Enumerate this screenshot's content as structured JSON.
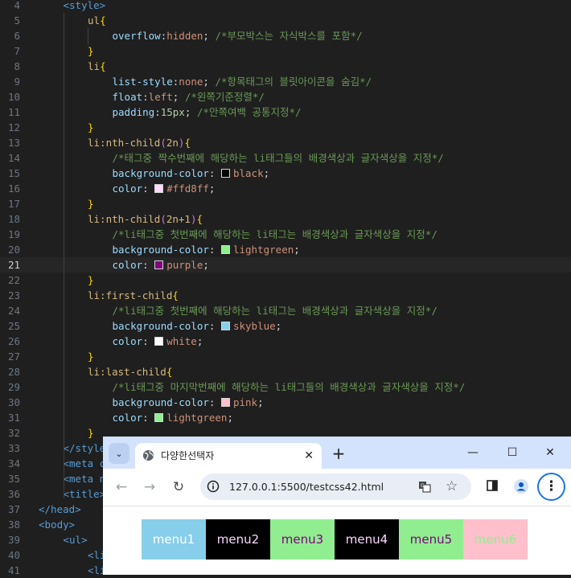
{
  "editor": {
    "active_line": "21",
    "lines": [
      {
        "num": "4",
        "tokens": [
          {
            "t": "tag",
            "v": "<style>"
          }
        ]
      },
      {
        "num": "5",
        "tokens": [
          {
            "t": "sel",
            "v": "ul"
          },
          {
            "t": "brace",
            "v": "{"
          }
        ]
      },
      {
        "num": "6",
        "tokens": [
          {
            "t": "prop",
            "v": "overflow"
          },
          {
            "t": "txt",
            "v": ":"
          },
          {
            "t": "val",
            "v": "hidden"
          },
          {
            "t": "txt",
            "v": "; "
          },
          {
            "t": "com",
            "v": "/*부모박스는 자식박스를 포함*/"
          }
        ]
      },
      {
        "num": "7",
        "tokens": [
          {
            "t": "brace",
            "v": "}"
          }
        ]
      },
      {
        "num": "8",
        "tokens": [
          {
            "t": "sel",
            "v": "li"
          },
          {
            "t": "brace",
            "v": "{"
          }
        ]
      },
      {
        "num": "9",
        "tokens": [
          {
            "t": "prop",
            "v": "list-style"
          },
          {
            "t": "txt",
            "v": ":"
          },
          {
            "t": "val",
            "v": "none"
          },
          {
            "t": "txt",
            "v": "; "
          },
          {
            "t": "com",
            "v": "/*항목태그의 블릿아이콘을 숨김*/"
          }
        ]
      },
      {
        "num": "10",
        "tokens": [
          {
            "t": "prop",
            "v": "float"
          },
          {
            "t": "txt",
            "v": ":"
          },
          {
            "t": "val",
            "v": "left"
          },
          {
            "t": "txt",
            "v": "; "
          },
          {
            "t": "com",
            "v": "/*왼쪽기준정렬*/"
          }
        ]
      },
      {
        "num": "11",
        "tokens": [
          {
            "t": "prop",
            "v": "padding"
          },
          {
            "t": "txt",
            "v": ":"
          },
          {
            "t": "num",
            "v": "15px"
          },
          {
            "t": "txt",
            "v": "; "
          },
          {
            "t": "com",
            "v": "/*안쪽여백 공통지정*/"
          }
        ]
      },
      {
        "num": "12",
        "tokens": [
          {
            "t": "brace",
            "v": "}"
          }
        ]
      },
      {
        "num": "13",
        "tokens": [
          {
            "t": "sel",
            "v": "li:nth-child"
          },
          {
            "t": "paren",
            "v": "("
          },
          {
            "t": "sel",
            "v": "2n"
          },
          {
            "t": "paren",
            "v": ")"
          },
          {
            "t": "brace",
            "v": "{"
          }
        ]
      },
      {
        "num": "14",
        "tokens": [
          {
            "t": "com",
            "v": "/*태그중 짝수번째에 해당하는 li태그들의 배경색상과 글자색상을 지정*/"
          }
        ]
      },
      {
        "num": "15",
        "tokens": [
          {
            "t": "prop",
            "v": "background-color"
          },
          {
            "t": "txt",
            "v": ": "
          },
          {
            "t": "swatch",
            "v": "#000000"
          },
          {
            "t": "val",
            "v": "black"
          },
          {
            "t": "txt",
            "v": ";"
          }
        ]
      },
      {
        "num": "16",
        "tokens": [
          {
            "t": "prop",
            "v": "color"
          },
          {
            "t": "txt",
            "v": ": "
          },
          {
            "t": "swatch",
            "v": "#ffd8ff"
          },
          {
            "t": "val",
            "v": "#ffd8ff"
          },
          {
            "t": "txt",
            "v": ";"
          }
        ]
      },
      {
        "num": "17",
        "tokens": [
          {
            "t": "brace",
            "v": "}"
          }
        ]
      },
      {
        "num": "18",
        "tokens": [
          {
            "t": "sel",
            "v": "li:nth-child"
          },
          {
            "t": "paren",
            "v": "("
          },
          {
            "t": "sel",
            "v": "2n+1"
          },
          {
            "t": "paren",
            "v": ")"
          },
          {
            "t": "brace",
            "v": "{"
          }
        ]
      },
      {
        "num": "19",
        "tokens": [
          {
            "t": "com",
            "v": "/*li태그중 첫번째에 해당하는 li태그는 배경색상과 글자색상을 지정*/"
          }
        ]
      },
      {
        "num": "20",
        "tokens": [
          {
            "t": "prop",
            "v": "background-color"
          },
          {
            "t": "txt",
            "v": ": "
          },
          {
            "t": "swatch",
            "v": "#90ee90"
          },
          {
            "t": "val",
            "v": "lightgreen"
          },
          {
            "t": "txt",
            "v": ";"
          }
        ]
      },
      {
        "num": "21",
        "tokens": [
          {
            "t": "prop",
            "v": "color"
          },
          {
            "t": "txt",
            "v": ": "
          },
          {
            "t": "swatch",
            "v": "#800080"
          },
          {
            "t": "val",
            "v": "purple"
          },
          {
            "t": "txt",
            "v": ";"
          }
        ]
      },
      {
        "num": "22",
        "tokens": [
          {
            "t": "brace",
            "v": "}"
          }
        ]
      },
      {
        "num": "23",
        "tokens": [
          {
            "t": "sel",
            "v": "li:first-child"
          },
          {
            "t": "brace",
            "v": "{"
          }
        ]
      },
      {
        "num": "24",
        "tokens": [
          {
            "t": "com",
            "v": "/*li태그중 첫번째에 해당하는 li태그는 배경색상과 글자색상을 지정*/"
          }
        ]
      },
      {
        "num": "25",
        "tokens": [
          {
            "t": "prop",
            "v": "background-color"
          },
          {
            "t": "txt",
            "v": ": "
          },
          {
            "t": "swatch",
            "v": "#87ceeb"
          },
          {
            "t": "val",
            "v": "skyblue"
          },
          {
            "t": "txt",
            "v": ";"
          }
        ]
      },
      {
        "num": "26",
        "tokens": [
          {
            "t": "prop",
            "v": "color"
          },
          {
            "t": "txt",
            "v": ": "
          },
          {
            "t": "swatch",
            "v": "#ffffff"
          },
          {
            "t": "val",
            "v": "white"
          },
          {
            "t": "txt",
            "v": ";"
          }
        ]
      },
      {
        "num": "27",
        "tokens": [
          {
            "t": "brace",
            "v": "}"
          }
        ]
      },
      {
        "num": "28",
        "tokens": [
          {
            "t": "sel",
            "v": "li:last-child"
          },
          {
            "t": "brace",
            "v": "{"
          }
        ]
      },
      {
        "num": "29",
        "tokens": [
          {
            "t": "com",
            "v": "/*li태그중 마지막번째에 해당하는 li태그들의 배경색상과 글자색상을 지정*/"
          }
        ]
      },
      {
        "num": "30",
        "tokens": [
          {
            "t": "prop",
            "v": "background-color"
          },
          {
            "t": "txt",
            "v": ": "
          },
          {
            "t": "swatch",
            "v": "#ffc0cb"
          },
          {
            "t": "val",
            "v": "pink"
          },
          {
            "t": "txt",
            "v": ";"
          }
        ]
      },
      {
        "num": "31",
        "tokens": [
          {
            "t": "prop",
            "v": "color"
          },
          {
            "t": "txt",
            "v": ": "
          },
          {
            "t": "swatch",
            "v": "#90ee90"
          },
          {
            "t": "val",
            "v": "lightgreen"
          },
          {
            "t": "txt",
            "v": ";"
          }
        ]
      },
      {
        "num": "32",
        "tokens": [
          {
            "t": "brace",
            "v": "}"
          }
        ]
      },
      {
        "num": "33",
        "tokens": [
          {
            "t": "tag",
            "v": "</style"
          }
        ]
      },
      {
        "num": "34",
        "tokens": [
          {
            "t": "tag",
            "v": "<meta c"
          }
        ]
      },
      {
        "num": "35",
        "tokens": [
          {
            "t": "tag",
            "v": "<meta n"
          }
        ]
      },
      {
        "num": "36",
        "tokens": [
          {
            "t": "tag",
            "v": "<title>"
          }
        ]
      },
      {
        "num": "37",
        "tokens": [
          {
            "t": "tag",
            "v": "</head>"
          }
        ]
      },
      {
        "num": "38",
        "tokens": [
          {
            "t": "tag",
            "v": "<body>"
          }
        ]
      },
      {
        "num": "39",
        "tokens": [
          {
            "t": "tag",
            "v": "<ul>"
          }
        ]
      },
      {
        "num": "40",
        "tokens": [
          {
            "t": "tag",
            "v": "<li"
          }
        ]
      },
      {
        "num": "41",
        "tokens": [
          {
            "t": "tag",
            "v": "<li"
          }
        ]
      }
    ]
  },
  "browser": {
    "tab_title": "다양한선택자",
    "tab_close": "✕",
    "new_tab": "+",
    "window": {
      "minimize": "—",
      "maximize": "☐",
      "close": "✕"
    },
    "nav": {
      "back": "←",
      "forward": "→",
      "reload": "↻"
    },
    "url": "127.0.0.1:5500/testcss42.html",
    "star": "☆",
    "menu": "⋮",
    "tab_search": "⌄",
    "icons": [
      "globe-icon",
      "site-info-icon",
      "translate-icon",
      "star-icon",
      "side-panel-icon",
      "profile-icon",
      "kebab-menu-icon"
    ]
  },
  "page": {
    "menu_items": [
      {
        "label": "menu1",
        "bg": "#87ceeb",
        "color": "#ffffff"
      },
      {
        "label": "menu2",
        "bg": "#000000",
        "color": "#ffd8ff"
      },
      {
        "label": "menu3",
        "bg": "#90ee90",
        "color": "#800080"
      },
      {
        "label": "menu4",
        "bg": "#000000",
        "color": "#ffd8ff"
      },
      {
        "label": "menu5",
        "bg": "#90ee90",
        "color": "#800080"
      },
      {
        "label": "menu6",
        "bg": "#ffc0cb",
        "color": "#90ee90"
      }
    ]
  }
}
